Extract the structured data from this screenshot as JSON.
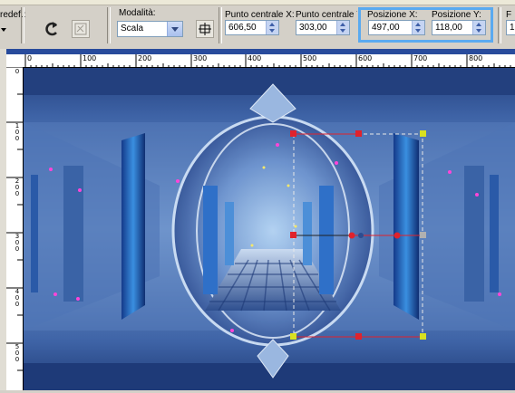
{
  "toolbar": {
    "predef_label": "redef.:",
    "modality_label": "Modalità:",
    "modality_value": "Scala",
    "center_x_label": "Punto centrale X:",
    "center_x_value": "606,50",
    "center_y_label": "Punto centrale Y:",
    "center_y_value": "303,00",
    "pos_x_label": "Posizione X:",
    "pos_x_value": "497,00",
    "pos_y_label": "Posizione Y:",
    "pos_y_value": "118,00",
    "right_label": "F",
    "right_value": "1"
  },
  "ruler": {
    "h_labels": [
      "0",
      "100",
      "200",
      "300",
      "400",
      "500",
      "600",
      "700",
      "800"
    ],
    "v_labels": [
      "0",
      "1\n0\n0",
      "2\n0\n0",
      "3\n0\n0",
      "4\n0\n0",
      "5\n0\n0"
    ]
  },
  "colors": {
    "highlight": "#5aaaf0",
    "canvas_bg": "#284b9c",
    "handle_red": "#e0222c",
    "handle_yellow": "#d8e020"
  },
  "icons": [
    "reset-icon",
    "object-icon",
    "toggle-icon"
  ]
}
